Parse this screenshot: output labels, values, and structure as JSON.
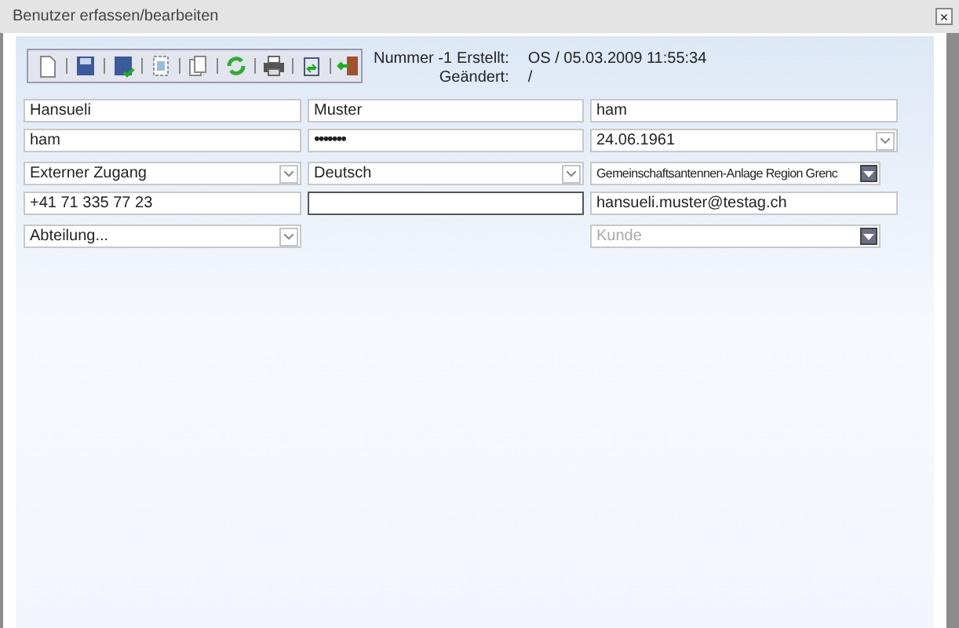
{
  "window": {
    "title": "Benutzer erfassen/bearbeiten",
    "close": "×"
  },
  "record": {
    "number": "Nummer -1",
    "created_label": "Erstellt:",
    "created": "OS / 05.03.2009 11:55:34",
    "changed_label": "Geändert:",
    "changed": "/"
  },
  "rows": [
    [
      {
        "kind": "text",
        "value": "Hansueli"
      },
      {
        "kind": "text",
        "value": "Muster"
      },
      {
        "kind": "text",
        "value": "ham"
      }
    ],
    [
      {
        "kind": "text",
        "value": "ham"
      },
      {
        "kind": "password",
        "value": "•••••••"
      },
      {
        "kind": "select",
        "value": "24.06.1961"
      }
    ],
    [
      {
        "kind": "select",
        "value": "Externer Zugang"
      },
      {
        "kind": "select",
        "value": "Deutsch"
      },
      {
        "kind": "combo",
        "value": "Gemeinschaftsantennen-Anlage Region Grenc"
      }
    ],
    [
      {
        "kind": "text",
        "value": "+41 71 335 77 23"
      },
      {
        "kind": "text",
        "focused": true
      },
      {
        "kind": "text",
        "value": "hansueli.muster@testag.ch"
      }
    ],
    [
      {
        "kind": "select",
        "value": "Abteilung..."
      },
      {
        "kind": "empty"
      },
      {
        "kind": "combo",
        "placeholder": "Kunde"
      }
    ]
  ]
}
